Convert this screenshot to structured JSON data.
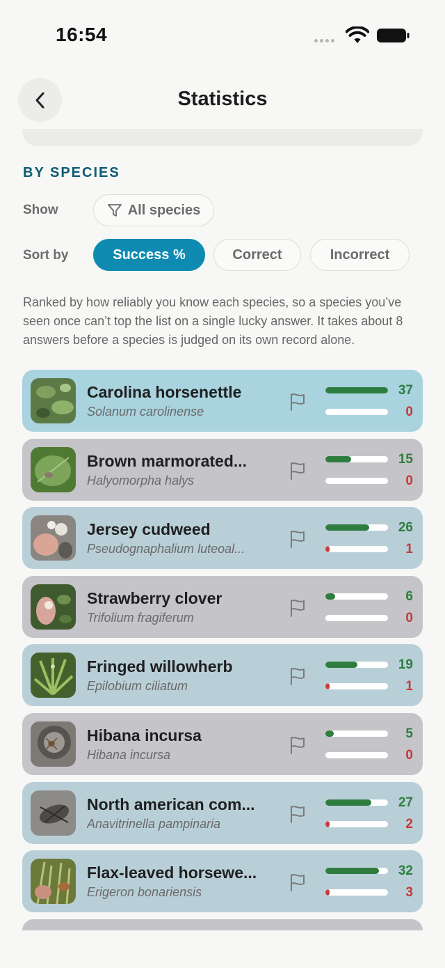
{
  "status_bar": {
    "time": "16:54"
  },
  "nav": {
    "title": "Statistics"
  },
  "section": {
    "heading": "BY SPECIES"
  },
  "filters": {
    "show_label": "Show",
    "show_value": "All species",
    "sort_label": "Sort by",
    "sort_options": [
      "Success %",
      "Correct",
      "Incorrect"
    ],
    "sort_selected": "Success %"
  },
  "explanation": "Ranked by how reliably you know each species, so a species you’ve seen once can’t top the list on a single lucky answer. It takes about 8 answers before a species is judged on its own record alone.",
  "colors": {
    "accent": "#0f8bb1",
    "heading": "#0e5b73",
    "correct": "#2e7d3f",
    "incorrect": "#c93c3c",
    "row_blue": "#a9d3df",
    "row_grey": "#c5c4c8"
  },
  "species": [
    {
      "name": "Carolina horsenettle",
      "scientific": "Solanum carolinense",
      "correct": "37",
      "incorrect": "0",
      "correct_fraction": 1.0,
      "incorrect_fraction": 0.0
    },
    {
      "name": "Brown marmorated...",
      "scientific": "Halyomorpha halys",
      "correct": "15",
      "incorrect": "0",
      "correct_fraction": 0.41,
      "incorrect_fraction": 0.0
    },
    {
      "name": "Jersey cudweed",
      "scientific": "Pseudognaphalium luteoal...",
      "correct": "26",
      "incorrect": "1",
      "correct_fraction": 0.7,
      "incorrect_fraction": 0.07
    },
    {
      "name": "Strawberry clover",
      "scientific": "Trifolium fragiferum",
      "correct": "6",
      "incorrect": "0",
      "correct_fraction": 0.16,
      "incorrect_fraction": 0.0
    },
    {
      "name": "Fringed willowherb",
      "scientific": "Epilobium ciliatum",
      "correct": "19",
      "incorrect": "1",
      "correct_fraction": 0.51,
      "incorrect_fraction": 0.07
    },
    {
      "name": "Hibana incursa",
      "scientific": "Hibana incursa",
      "correct": "5",
      "incorrect": "0",
      "correct_fraction": 0.13,
      "incorrect_fraction": 0.0
    },
    {
      "name": "North american com...",
      "scientific": "Anavitrinella pampinaria",
      "correct": "27",
      "incorrect": "2",
      "correct_fraction": 0.73,
      "incorrect_fraction": 0.07
    },
    {
      "name": "Flax-leaved horsewe...",
      "scientific": "Erigeron bonariensis",
      "correct": "32",
      "incorrect": "3",
      "correct_fraction": 0.86,
      "incorrect_fraction": 0.07
    }
  ]
}
